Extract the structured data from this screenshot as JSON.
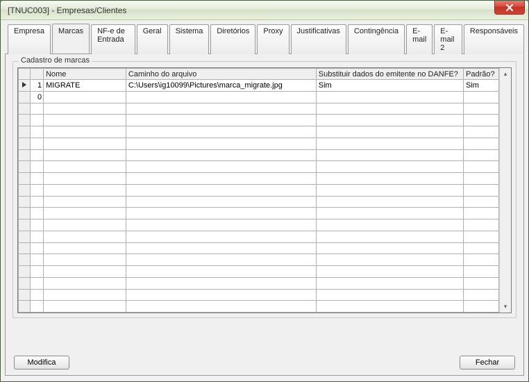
{
  "window": {
    "title": "[TNUC003] - Empresas/Clientes"
  },
  "tabs": [
    {
      "label": "Empresa",
      "active": false
    },
    {
      "label": "Marcas",
      "active": true
    },
    {
      "label": "NF-e de Entrada",
      "active": false
    },
    {
      "label": "Geral",
      "active": false
    },
    {
      "label": "Sistema",
      "active": false
    },
    {
      "label": "Diretórios",
      "active": false
    },
    {
      "label": "Proxy",
      "active": false
    },
    {
      "label": "Justificativas",
      "active": false
    },
    {
      "label": "Contingência",
      "active": false
    },
    {
      "label": "E-mail",
      "active": false
    },
    {
      "label": "E-mail 2",
      "active": false
    },
    {
      "label": "Responsáveis",
      "active": false
    }
  ],
  "groupbox": {
    "legend": "Cadastro de marcas"
  },
  "grid": {
    "columns": {
      "id": "",
      "nome": "Nome",
      "caminho": "Caminho do arquivo",
      "substituir": "Substituir dados do emitente no DANFE?",
      "padrao": "Padrão?"
    },
    "rows": [
      {
        "indicator": true,
        "id": "1",
        "nome": "MIGRATE",
        "caminho": "C:\\Users\\ig10099\\Pictures\\marca_migrate.jpg",
        "substituir": "Sim",
        "padrao": "Sim"
      },
      {
        "indicator": false,
        "id": "0",
        "nome": "",
        "caminho": "",
        "substituir": "",
        "padrao": ""
      }
    ]
  },
  "buttons": {
    "modify": "Modifica",
    "close": "Fechar"
  }
}
